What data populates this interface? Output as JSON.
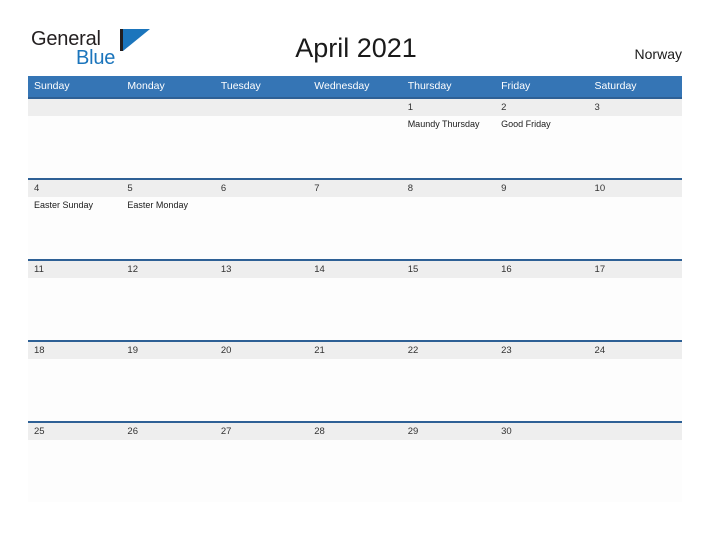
{
  "brand": {
    "name_part1": "General",
    "name_part2": "Blue",
    "logo_icon": "triangle-flag-mark",
    "color_dark": "#231f20",
    "color_blue": "#1b75bc"
  },
  "header": {
    "title": "April 2021",
    "country": "Norway"
  },
  "theme": {
    "header_blue": "#3575b5",
    "row_separator": "#2e6095",
    "date_band": "#eeeeee",
    "cell_background": "#fdfdfd"
  },
  "calendar": {
    "weekdays": [
      "Sunday",
      "Monday",
      "Tuesday",
      "Wednesday",
      "Thursday",
      "Friday",
      "Saturday"
    ],
    "weeks": [
      {
        "days": [
          {
            "num": "",
            "events": []
          },
          {
            "num": "",
            "events": []
          },
          {
            "num": "",
            "events": []
          },
          {
            "num": "",
            "events": []
          },
          {
            "num": "1",
            "events": [
              "Maundy Thursday"
            ]
          },
          {
            "num": "2",
            "events": [
              "Good Friday"
            ]
          },
          {
            "num": "3",
            "events": []
          }
        ]
      },
      {
        "days": [
          {
            "num": "4",
            "events": [
              "Easter Sunday"
            ]
          },
          {
            "num": "5",
            "events": [
              "Easter Monday"
            ]
          },
          {
            "num": "6",
            "events": []
          },
          {
            "num": "7",
            "events": []
          },
          {
            "num": "8",
            "events": []
          },
          {
            "num": "9",
            "events": []
          },
          {
            "num": "10",
            "events": []
          }
        ]
      },
      {
        "days": [
          {
            "num": "11",
            "events": []
          },
          {
            "num": "12",
            "events": []
          },
          {
            "num": "13",
            "events": []
          },
          {
            "num": "14",
            "events": []
          },
          {
            "num": "15",
            "events": []
          },
          {
            "num": "16",
            "events": []
          },
          {
            "num": "17",
            "events": []
          }
        ]
      },
      {
        "days": [
          {
            "num": "18",
            "events": []
          },
          {
            "num": "19",
            "events": []
          },
          {
            "num": "20",
            "events": []
          },
          {
            "num": "21",
            "events": []
          },
          {
            "num": "22",
            "events": []
          },
          {
            "num": "23",
            "events": []
          },
          {
            "num": "24",
            "events": []
          }
        ]
      },
      {
        "days": [
          {
            "num": "25",
            "events": []
          },
          {
            "num": "26",
            "events": []
          },
          {
            "num": "27",
            "events": []
          },
          {
            "num": "28",
            "events": []
          },
          {
            "num": "29",
            "events": []
          },
          {
            "num": "30",
            "events": []
          },
          {
            "num": "",
            "events": []
          }
        ]
      }
    ]
  }
}
